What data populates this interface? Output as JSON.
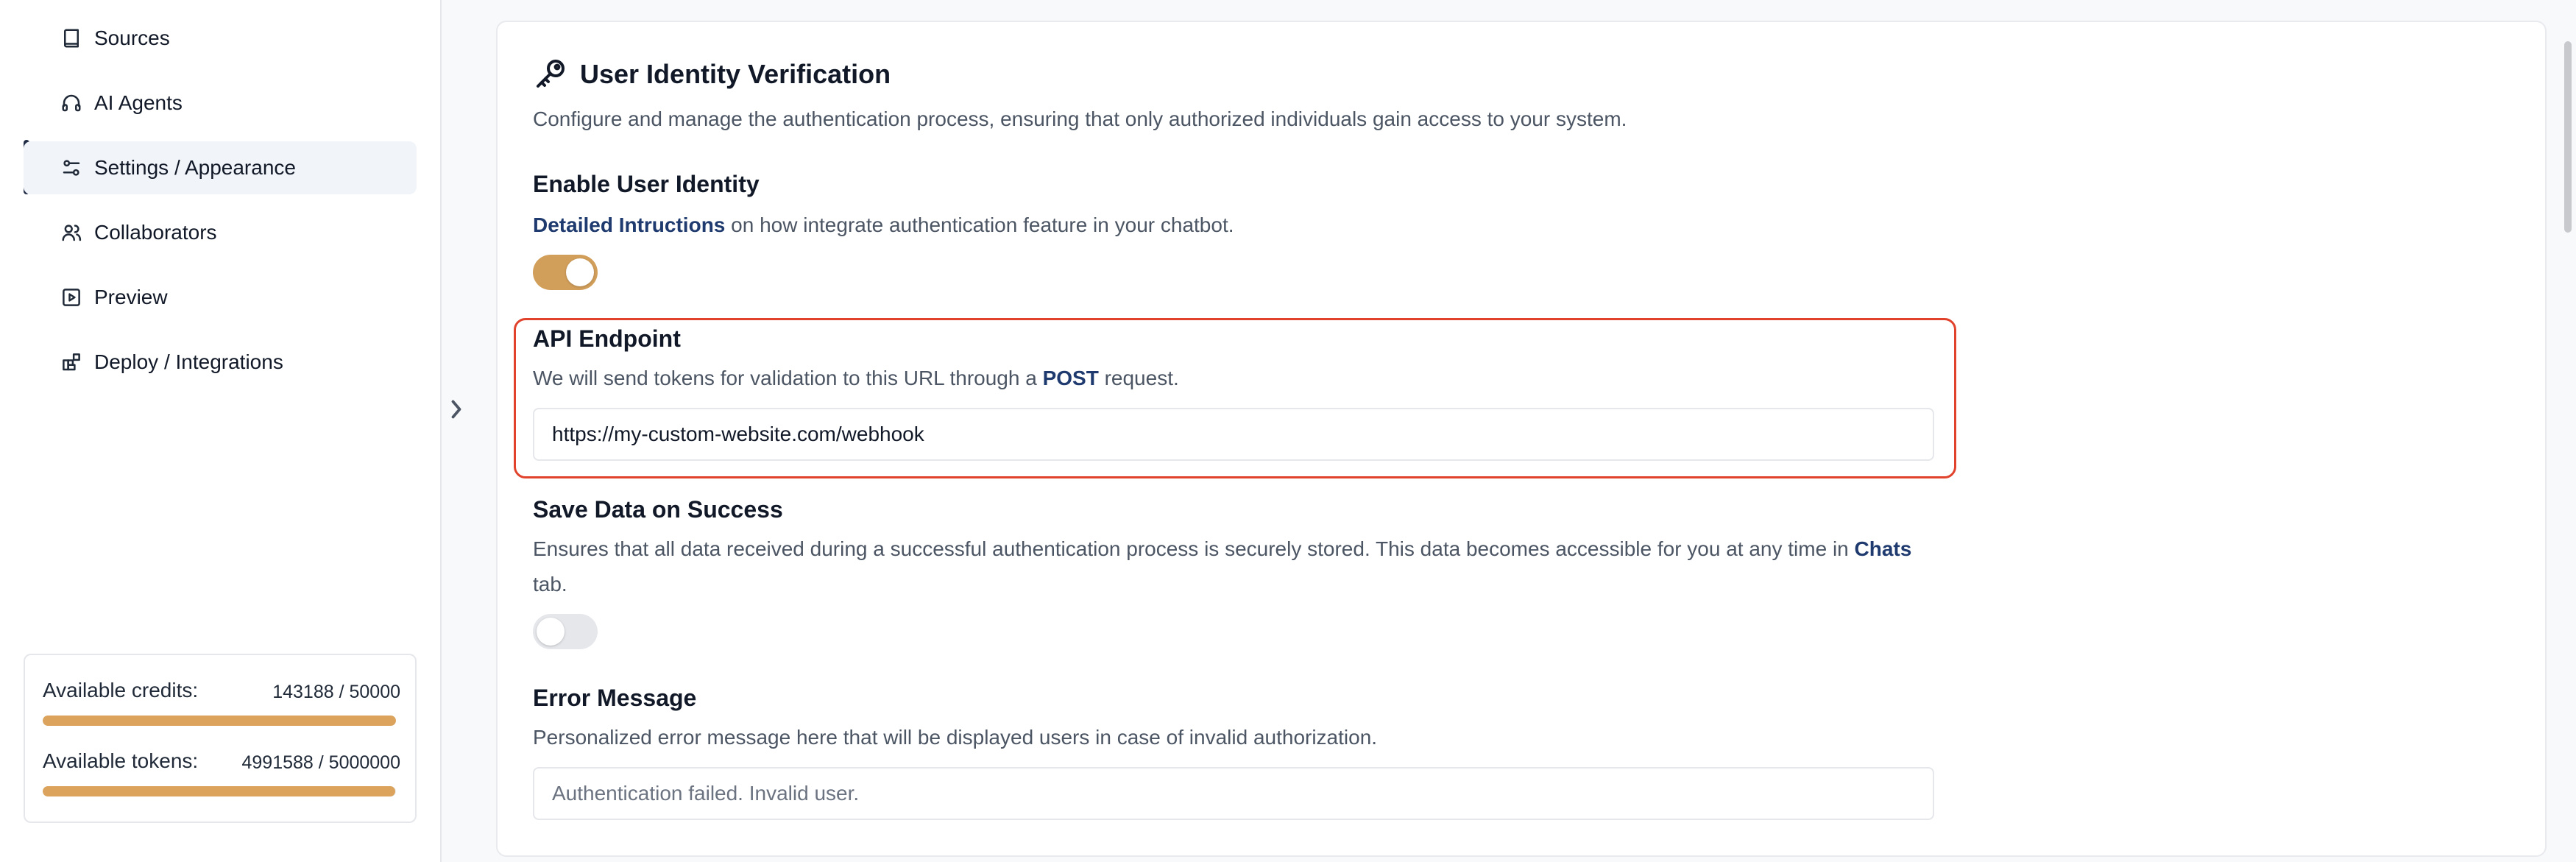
{
  "sidebar": {
    "items": [
      {
        "label": "Sources",
        "icon": "book-icon"
      },
      {
        "label": "AI Agents",
        "icon": "headphones-icon"
      },
      {
        "label": "Settings / Appearance",
        "icon": "settings-sliders-icon",
        "active": true
      },
      {
        "label": "Collaborators",
        "icon": "users-icon"
      },
      {
        "label": "Preview",
        "icon": "play-square-icon"
      },
      {
        "label": "Deploy / Integrations",
        "icon": "blocks-icon"
      }
    ],
    "usage": {
      "credits_label": "Available credits:",
      "credits_value": "143188 / 50000",
      "credits_fill": 1.0,
      "tokens_label": "Available tokens:",
      "tokens_value": "4991588 / 5000000",
      "tokens_fill": 0.998
    },
    "accent_color": "#dba35c"
  },
  "main": {
    "title": "User Identity Verification",
    "title_icon": "key-icon",
    "subtitle": "Configure and manage the authentication process, ensuring that only authorized individuals gain access to your system.",
    "enable_identity": {
      "heading": "Enable User Identity",
      "link_text": "Detailed Intructions",
      "desc_rest": " on how integrate authentication feature in your chatbot.",
      "enabled": true
    },
    "api_endpoint": {
      "heading": "API Endpoint",
      "desc_pre": "We will send tokens for validation to this URL through a ",
      "desc_bold": "POST",
      "desc_post": " request.",
      "value": "https://my-custom-website.com/webhook",
      "highlight_color": "#e0422c"
    },
    "save_data": {
      "heading": "Save Data on Success",
      "desc_pre": "Ensures that all data received during a successful authentication process is securely stored. This data becomes accessible for you at any time in ",
      "desc_bold": "Chats",
      "desc_post": " tab.",
      "enabled": false
    },
    "error_message": {
      "heading": "Error Message",
      "desc": "Personalized error message here that will be displayed users in case of invalid authorization.",
      "placeholder": "Authentication failed. Invalid user."
    },
    "toggle_color": "#d29f5b"
  }
}
